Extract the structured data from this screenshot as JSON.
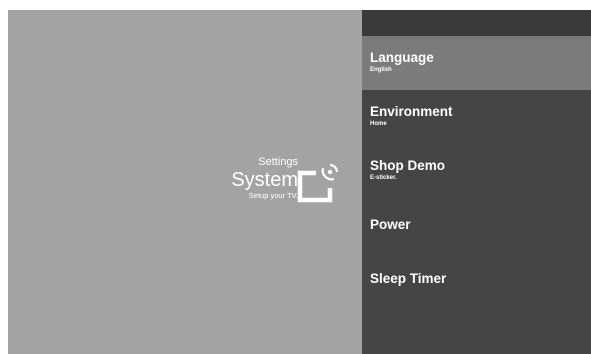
{
  "header": {
    "section": "Settings",
    "title": "System",
    "subtitle": "Setup your TV."
  },
  "icon": "cast-tv-icon",
  "colors": {
    "left_background": "#a3a3a3",
    "menu_background": "#454545",
    "selected_background": "#7b7b7b",
    "text": "#ffffff"
  },
  "menu": {
    "items": [
      {
        "label": "Language",
        "value": "English"
      },
      {
        "label": "Environment",
        "value": "Home"
      },
      {
        "label": "Shop Demo",
        "value": "E-sticker."
      },
      {
        "label": "Power"
      },
      {
        "label": "Sleep Timer"
      }
    ],
    "selected": "Language"
  }
}
